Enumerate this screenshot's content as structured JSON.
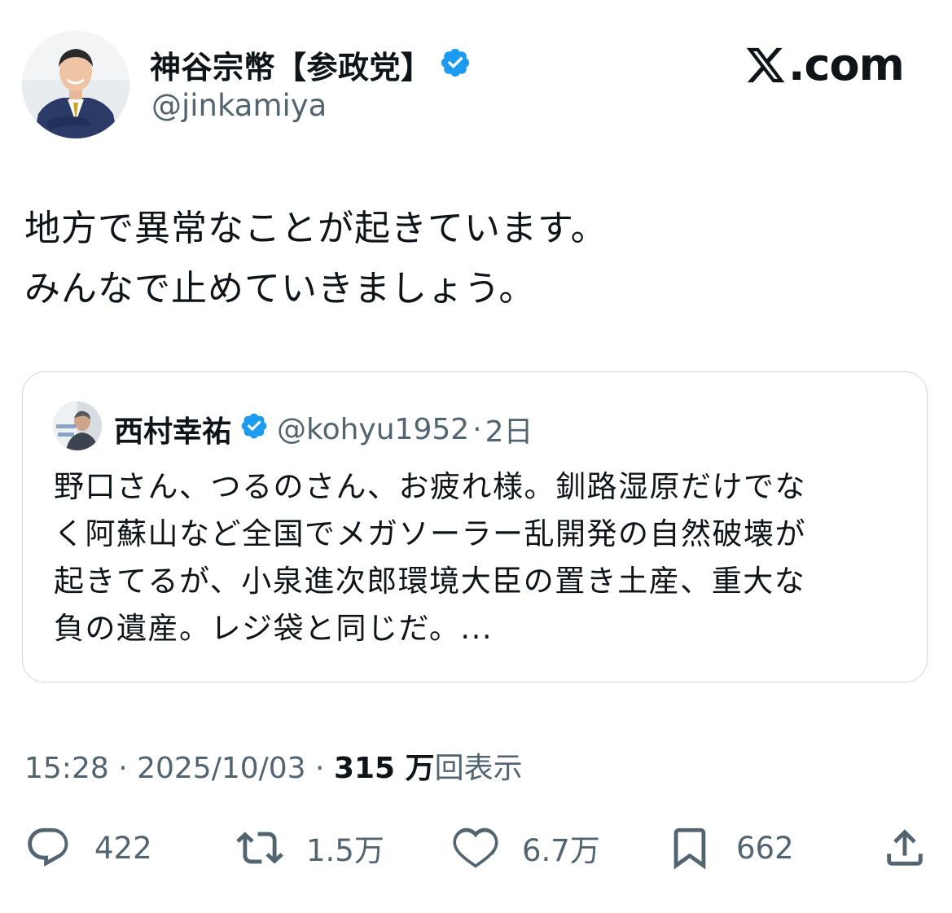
{
  "author": {
    "name": "神谷宗幣【参政党】",
    "handle": "@jinkamiya",
    "verified": true
  },
  "brand": {
    "text": ".com"
  },
  "tweet": {
    "lines": [
      "地方で異常なことが起きています。",
      "みんなで止めていきましょう。"
    ]
  },
  "quote": {
    "name": "西村幸祐",
    "handle": "@kohyu1952",
    "separator": "·",
    "time": "2日",
    "lines": [
      "野口さん、つるのさん、お疲れ様。釧路湿原だけでな",
      "く阿蘇山など全国でメガソーラー乱開発の自然破壊が",
      "起きてるが、小泉進次郎環境大臣の置き土産、重大な",
      "負の遺産。レジ袋と同じだ。..."
    ]
  },
  "meta": {
    "time": "15:28",
    "sep1": " · ",
    "date": "2025/10/03",
    "sep2": " · ",
    "views_count": "315 万",
    "views_label": "回表示"
  },
  "actions": {
    "replies": "422",
    "retweets": "1.5万",
    "likes": "6.7万",
    "bookmarks": "662"
  },
  "colors": {
    "verified": "#1d9bf0",
    "text": "#0f1419",
    "secondary": "#536471",
    "border": "#cfd9de"
  }
}
